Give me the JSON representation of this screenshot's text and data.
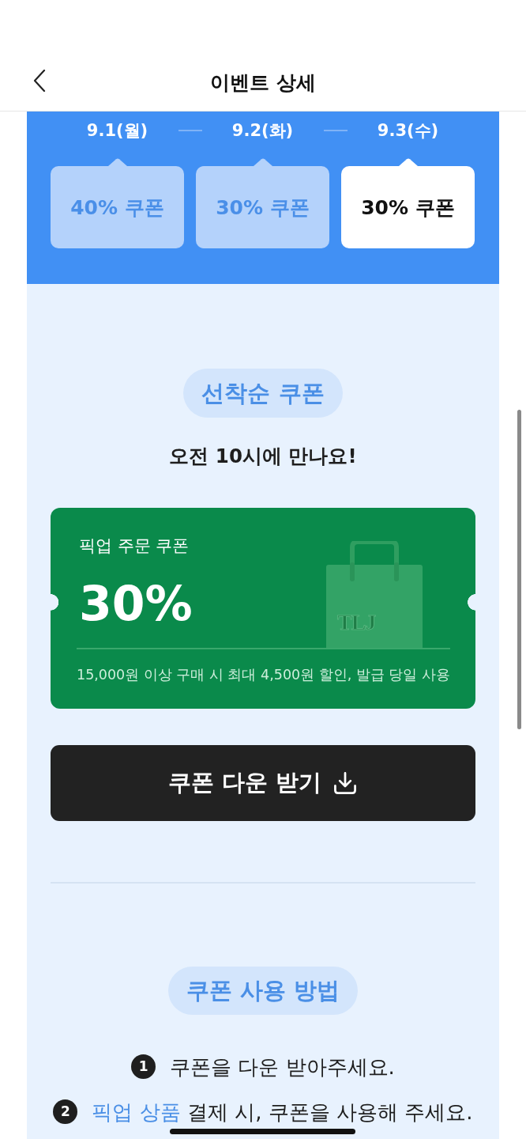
{
  "header": {
    "title": "이벤트 상세"
  },
  "schedule": [
    {
      "date": "9.1(월)",
      "coupon": "40% 쿠폰",
      "selected": false
    },
    {
      "date": "9.2(화)",
      "coupon": "30% 쿠폰",
      "selected": false
    },
    {
      "date": "9.3(수)",
      "coupon": "30% 쿠폰",
      "selected": true
    }
  ],
  "first_come": {
    "badge": "선착순 쿠폰",
    "subtitle": "오전 10시에 만나요!"
  },
  "coupon": {
    "label": "픽업 주문 쿠폰",
    "discount": "30%",
    "bag_logo": "TLJ",
    "terms": "15,000원 이상 구매 시 최대 4,500원 할인, 발급 당일 사용"
  },
  "download_button": {
    "label": "쿠폰 다운 받기"
  },
  "usage": {
    "badge": "쿠폰 사용 방법",
    "steps": [
      {
        "number": "1",
        "text": "쿠폰을 다운 받아주세요."
      },
      {
        "number": "2",
        "link": "픽업 상품",
        "text": "결제 시, 쿠폰을 사용해 주세요."
      }
    ]
  }
}
